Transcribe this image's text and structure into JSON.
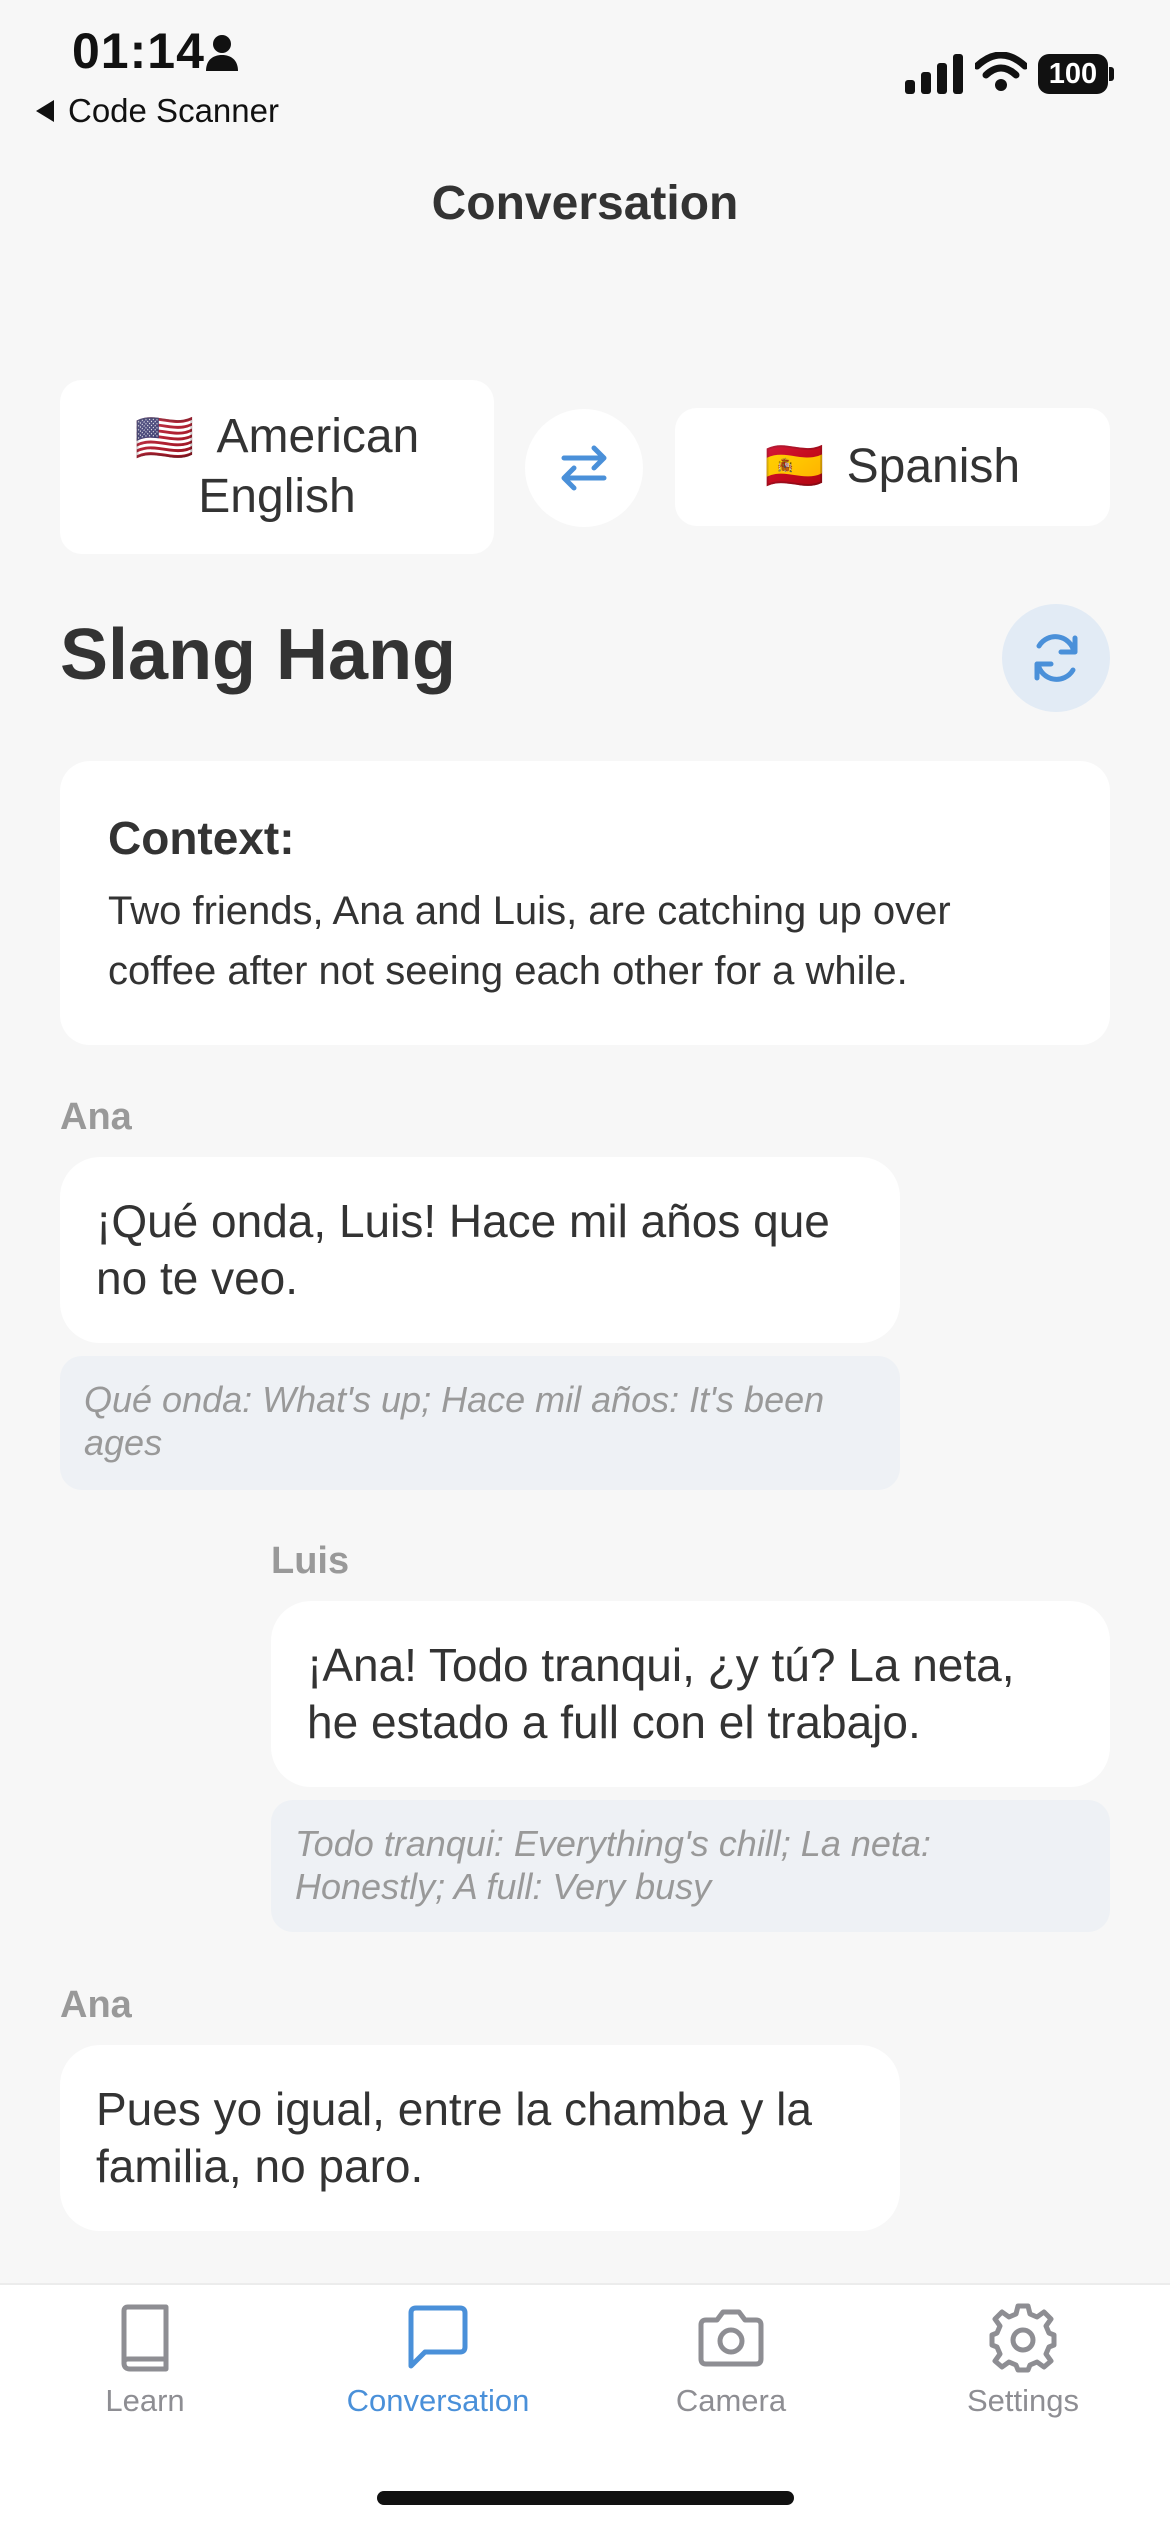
{
  "status_bar": {
    "time": "01:14",
    "back_app": "Code Scanner",
    "battery": "100"
  },
  "header": {
    "title": "Conversation"
  },
  "languages": {
    "source": {
      "flag": "🇺🇸",
      "name": "American English"
    },
    "target": {
      "flag": "🇪🇸",
      "name": "Spanish"
    }
  },
  "section": {
    "title": "Slang Hang"
  },
  "context": {
    "heading": "Context:",
    "text": "Two friends, Ana and Luis, are catching up over coffee after not seeing each other for a while."
  },
  "messages": [
    {
      "speaker": "Ana",
      "text": "¡Qué onda, Luis! Hace mil años que no te veo.",
      "note": "Qué onda: What's up; Hace mil años: It's been ages"
    },
    {
      "speaker": "Luis",
      "text": "¡Ana! Todo tranqui, ¿y tú? La neta, he estado a full con el trabajo.",
      "note": "Todo tranqui: Everything's chill; La neta: Honestly; A full: Very busy"
    },
    {
      "speaker": "Ana",
      "text": "Pues yo igual, entre la chamba y la familia, no paro.",
      "note": ""
    }
  ],
  "tabs": [
    {
      "label": "Learn",
      "icon": "book-icon",
      "active": false
    },
    {
      "label": "Conversation",
      "icon": "chat-bubble-icon",
      "active": true
    },
    {
      "label": "Camera",
      "icon": "camera-icon",
      "active": false
    },
    {
      "label": "Settings",
      "icon": "gear-icon",
      "active": false
    }
  ],
  "colors": {
    "accent": "#4a90d9",
    "background": "#f7f7f7",
    "note_background": "#eef1f5",
    "muted": "#999999"
  }
}
